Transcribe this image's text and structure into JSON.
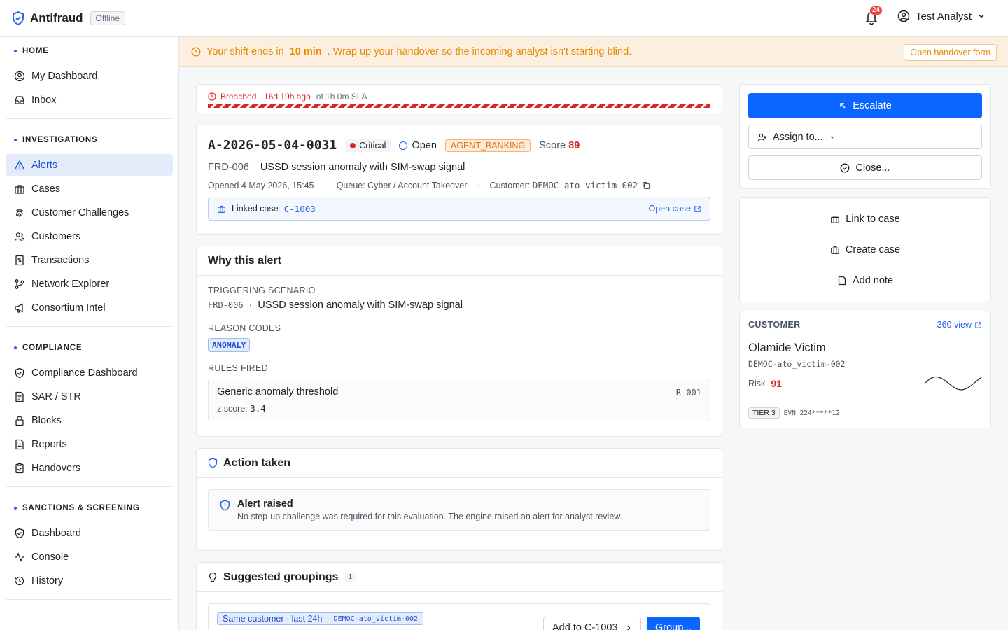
{
  "header": {
    "app_title": "Antifraud",
    "status_badge": "Offline",
    "notifications_count": "24",
    "user_name": "Test Analyst"
  },
  "sidebar": {
    "sections": [
      {
        "title": "HOME",
        "items": [
          {
            "label": "My Dashboard",
            "icon": "user-circle-icon"
          },
          {
            "label": "Inbox",
            "icon": "inbox-icon"
          }
        ]
      },
      {
        "title": "INVESTIGATIONS",
        "items": [
          {
            "label": "Alerts",
            "icon": "alert-triangle-icon",
            "active": true
          },
          {
            "label": "Cases",
            "icon": "briefcase-icon"
          },
          {
            "label": "Customer Challenges",
            "icon": "fingerprint-icon"
          },
          {
            "label": "Customers",
            "icon": "users-icon"
          },
          {
            "label": "Transactions",
            "icon": "receipt-icon"
          },
          {
            "label": "Network Explorer",
            "icon": "git-branch-icon"
          },
          {
            "label": "Consortium Intel",
            "icon": "megaphone-icon"
          }
        ]
      },
      {
        "title": "COMPLIANCE",
        "items": [
          {
            "label": "Compliance Dashboard",
            "icon": "shield-check-icon"
          },
          {
            "label": "SAR / STR",
            "icon": "file-text-icon"
          },
          {
            "label": "Blocks",
            "icon": "lock-icon"
          },
          {
            "label": "Reports",
            "icon": "file-icon"
          },
          {
            "label": "Handovers",
            "icon": "clipboard-check-icon"
          }
        ]
      },
      {
        "title": "SANCTIONS & SCREENING",
        "items": [
          {
            "label": "Dashboard",
            "icon": "shield-check-icon"
          },
          {
            "label": "Console",
            "icon": "activity-icon"
          },
          {
            "label": "History",
            "icon": "history-icon"
          }
        ]
      }
    ]
  },
  "banner": {
    "text_before": "Your shift ends in",
    "time": "10 min",
    "text_after": ". Wrap up your handover so the incoming analyst isn't starting blind.",
    "button": "Open handover form"
  },
  "sla": {
    "status": "Breached · 16d 19h ago",
    "of": "of 1h 0m SLA"
  },
  "alert": {
    "id": "A-2026-05-04-0031",
    "severity": "Critical",
    "status": "Open",
    "channel": "AGENT_BANKING",
    "score_label": "Score",
    "score": "89",
    "scenario_code": "FRD-006",
    "scenario_title": "USSD session anomaly with SIM-swap signal",
    "opened": "Opened 4 May 2026, 15:45",
    "queue": "Queue: Cyber / Account Takeover",
    "customer_label": "Customer:",
    "customer_id": "DEMOC-ato_victim-002",
    "linked_label": "Linked case",
    "linked_case": "C-1003",
    "open_case": "Open case"
  },
  "why": {
    "title": "Why this alert",
    "triggering_label": "TRIGGERING SCENARIO",
    "scenario_code": "FRD-006",
    "separator": "·",
    "scenario_title": "USSD session anomaly with SIM-swap signal",
    "reason_label": "REASON CODES",
    "reason_code": "ANOMALY",
    "rules_label": "RULES FIRED",
    "rule_name": "Generic anomaly threshold",
    "rule_id": "R-001",
    "z_label": "z score:",
    "z_value": "3.4"
  },
  "action": {
    "title": "Action taken",
    "raised_title": "Alert raised",
    "raised_desc": "No step-up challenge was required for this evaluation. The engine raised an alert for analyst review."
  },
  "groupings": {
    "title": "Suggested groupings",
    "count": "1",
    "chip_label": "Same customer · last 24h",
    "chip_sep": "·",
    "chip_id": "DEMOC-ato_victim-002",
    "add_button": "Add to C-1003",
    "group_button": "Group..."
  },
  "right_actions": {
    "escalate": "Escalate",
    "assign": "Assign to...",
    "close": "Close...",
    "link_case": "Link to case",
    "create_case": "Create case",
    "add_note": "Add note"
  },
  "customer": {
    "label": "CUSTOMER",
    "view_360": "360 view",
    "name": "Olamide Victim",
    "id": "DEMOC-ato_victim-002",
    "risk_label": "Risk",
    "risk": "91",
    "tier": "TIER 3",
    "bvn": "BVN 224*****12"
  },
  "colors": {
    "accent": "#0a66ff",
    "critical": "#dc2626",
    "warning": "#e68a00"
  }
}
